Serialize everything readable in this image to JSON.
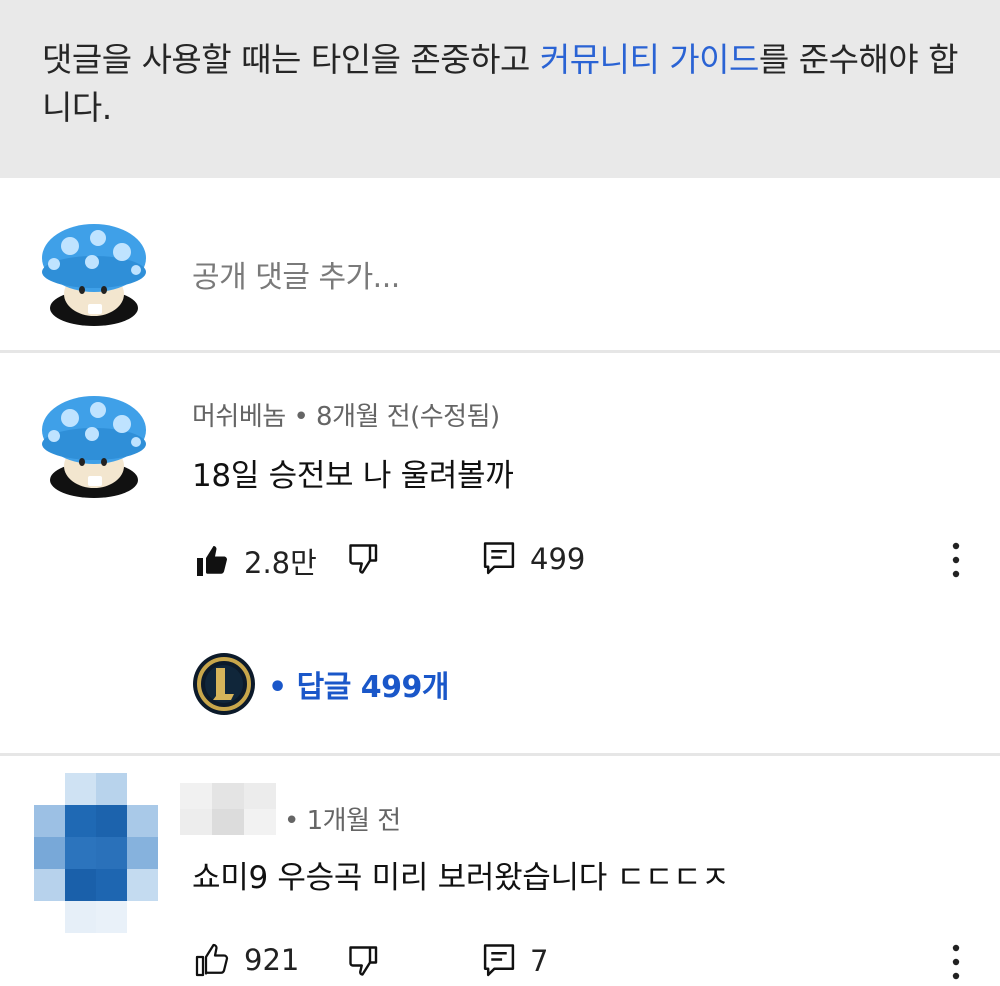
{
  "notice": {
    "prefix": "댓글을 사용할 때는 타인을 존중하고 ",
    "link": "커뮤니티 가이드",
    "suffix": "를 준수해야 합니다."
  },
  "add_comment": {
    "placeholder": "공개 댓글 추가..."
  },
  "comments": [
    {
      "author": "머쉬베놈",
      "time": "• 8개월 전(수정됨)",
      "text": "18일 승전보 나 울려볼까",
      "likes": "2.8만",
      "reply_count": "499",
      "replies_label": "• 답글 499개",
      "liked": true
    },
    {
      "author": "",
      "time": "• 1개월 전",
      "text": "쇼미9 우승곡 미리 보러왔습니다 ㄷㄷㄷㅈ",
      "likes": "921",
      "reply_count": "7",
      "liked": false
    }
  ],
  "colors": {
    "link": "#2a63d4",
    "replies": "#1a57c9",
    "notice_bg": "#e9e9e9"
  },
  "icons": [
    "mushroom-avatar",
    "thumbs-up-icon",
    "thumbs-down-icon",
    "reply-icon",
    "more-vert-icon",
    "lol-channel-avatar",
    "blurred-avatar"
  ]
}
